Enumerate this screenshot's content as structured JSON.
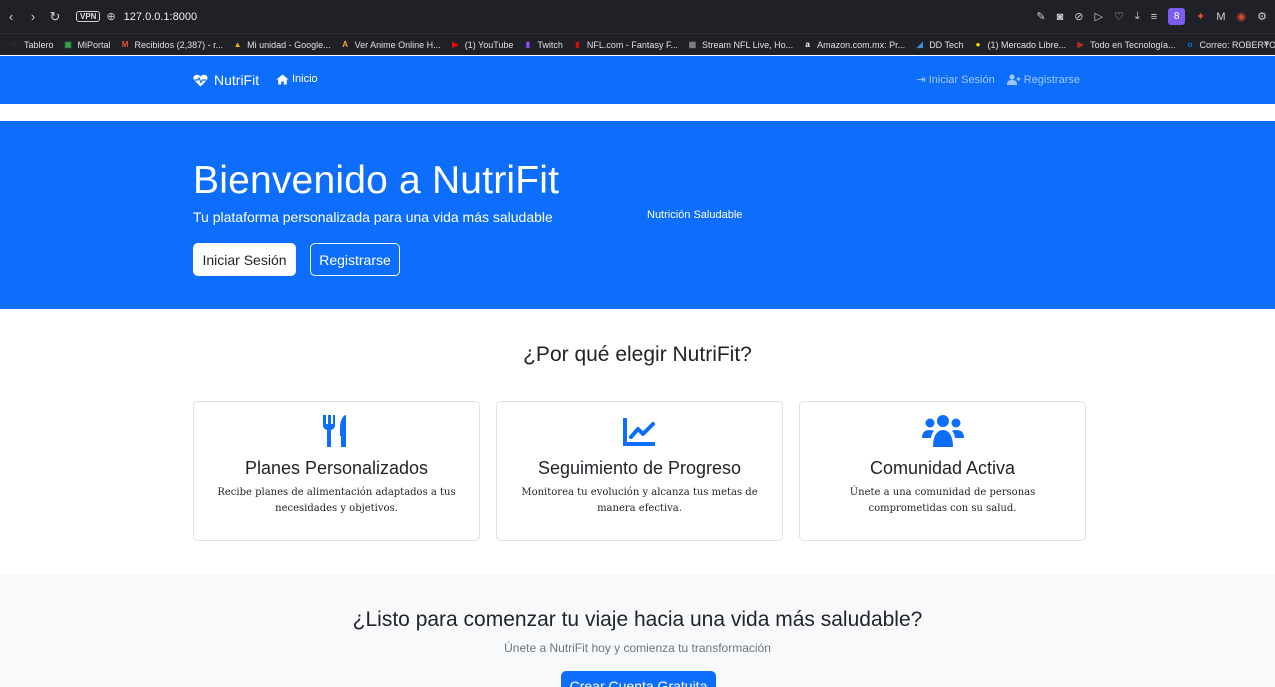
{
  "browser": {
    "url": "127.0.0.1:8000",
    "vpn_label": "VPN",
    "profile_initial": "8",
    "bookmarks": [
      {
        "label": "Tablero",
        "icon": "circle-icon",
        "color": "#e0523b"
      },
      {
        "label": "MiPortal",
        "icon": "portal-icon",
        "color": "#3aa655"
      },
      {
        "label": "Recibidos (2,387) - r...",
        "icon": "gmail-icon",
        "color": "#e0523b"
      },
      {
        "label": "Mi unidad - Google...",
        "icon": "drive-icon",
        "color": "#f4b400"
      },
      {
        "label": "Ver Anime Online H...",
        "icon": "anime-icon",
        "color": "#f2a93b"
      },
      {
        "label": "(1) YouTube",
        "icon": "youtube-icon",
        "color": "#ff0000"
      },
      {
        "label": "Twitch",
        "icon": "twitch-icon",
        "color": "#9146ff"
      },
      {
        "label": "NFL.com - Fantasy F...",
        "icon": "nfl-icon",
        "color": "#d50a0a"
      },
      {
        "label": "Stream NFL Live, Ho...",
        "icon": "stream-icon",
        "color": "#888888"
      },
      {
        "label": "Amazon.com.mx: Pr...",
        "icon": "amazon-icon",
        "color": "#ffffff"
      },
      {
        "label": "DD Tech",
        "icon": "ddtech-icon",
        "color": "#3a8fd6"
      },
      {
        "label": "(1) Mercado Libre...",
        "icon": "mercadolibre-icon",
        "color": "#ffe600"
      },
      {
        "label": "Todo en Tecnología...",
        "icon": "tech-icon",
        "color": "#c62828"
      },
      {
        "label": "Correo: ROBERTO A...",
        "icon": "outlook-icon",
        "color": "#0078d4"
      }
    ],
    "more": "»"
  },
  "nav": {
    "brand": "NutriFit",
    "home": "Inicio",
    "login": "Iniciar Sesión",
    "register": "Registrarse"
  },
  "hero": {
    "title": "Bienvenido a NutriFit",
    "subtitle": "Tu plataforma personalizada para una vida más saludable",
    "login_button": "Iniciar Sesión",
    "register_button": "Registrarse",
    "image_alt": "Nutrición Saludable"
  },
  "features": {
    "title": "¿Por qué elegir NutriFit?",
    "cards": [
      {
        "title": "Planes Personalizados",
        "text": "Recibe planes de alimentación adaptados a tus necesidades y objetivos.",
        "icon": "utensils-icon"
      },
      {
        "title": "Seguimiento de Progreso",
        "text": "Monitorea tu evolución y alcanza tus metas de manera efectiva.",
        "icon": "chart-line-icon"
      },
      {
        "title": "Comunidad Activa",
        "text": "Únete a una comunidad de personas comprometidas con su salud.",
        "icon": "users-icon"
      }
    ]
  },
  "cta": {
    "title": "¿Listo para comenzar tu viaje hacia una vida más saludable?",
    "subtitle": "Únete a NutriFit hoy y comienza tu transformación",
    "button": "Crear Cuenta Gratuita"
  },
  "colors": {
    "primary": "#0d6efd",
    "light_bg": "#f8f9fa"
  }
}
